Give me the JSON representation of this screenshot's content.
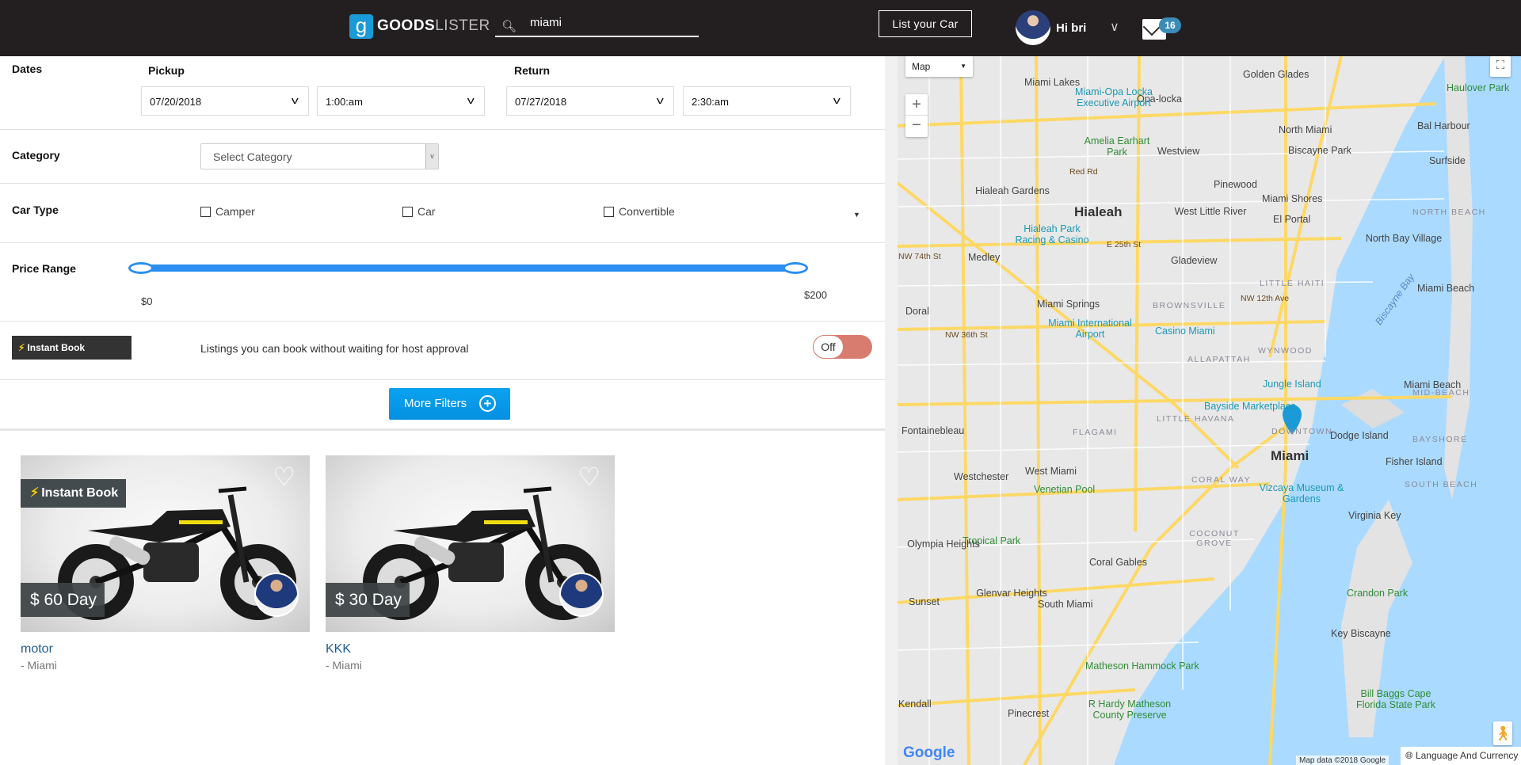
{
  "header": {
    "logo_bold": "GOODS",
    "logo_light": "LISTER",
    "search_value": "miami",
    "list_button": "List your Car",
    "greeting": "Hi bri",
    "message_count": "16"
  },
  "filters": {
    "dates_label": "Dates",
    "pickup_label": "Pickup",
    "return_label": "Return",
    "pickup_date": "07/20/2018",
    "pickup_time": "1:00:am",
    "return_date": "07/27/2018",
    "return_time": "2:30:am",
    "category_label": "Category",
    "category_placeholder": "Select Category",
    "car_type_label": "Car Type",
    "car_types": [
      {
        "label": "Camper",
        "checked": false
      },
      {
        "label": "Car",
        "checked": false
      },
      {
        "label": "Convertible",
        "checked": false
      }
    ],
    "price_label": "Price Range",
    "price_min": "$0",
    "price_max": "$200",
    "price_range_values": [
      0,
      200
    ],
    "instant_book_label": "Instant Book",
    "instant_book_desc": "Listings you can book without waiting for host approval",
    "instant_book_toggle": "Off",
    "more_filters": "More Filters"
  },
  "listings": [
    {
      "title": "motor",
      "location": "- Miami",
      "price": "$ 60 Day",
      "instant_book": "Instant Book"
    },
    {
      "title": "KKK",
      "location": "- Miami",
      "price": "$ 30 Day"
    }
  ],
  "map": {
    "type_select": "Map",
    "zoom_in": "+",
    "zoom_out": "−",
    "attribution": "Map data ©2018 Google",
    "google_logo": "Google",
    "language_button": "Language And Currency",
    "water_color": "#aadaff",
    "land_color": "#e8e8e8",
    "road_color": "#fdd865",
    "labels": [
      "Miami Lakes",
      "Golden Glades",
      "Opa-locka",
      "Miami-Opa Locka Executive Airport",
      "Haulover Park",
      "North Miami",
      "Bal Harbour",
      "Amelia Earhart Park",
      "Westview",
      "Biscayne Park",
      "Surfside",
      "Hialeah Gardens",
      "Pinewood",
      "Miami Shores",
      "Hialeah",
      "West Little River",
      "El Portal",
      "Hialeah Park Racing & Casino",
      "North Bay Village",
      "Medley",
      "Gladeview",
      "Miami Beach",
      "Biscayne Bay",
      "Doral",
      "Miami Springs",
      "Miami International Airport",
      "Casino Miami",
      "LITTLE HAITI",
      "BROWNSVILLE",
      "WYNWOOD",
      "ALLAPATTAH",
      "Jungle Island",
      "Miami Beach",
      "Bayside Marketplace",
      "Fontainebleau",
      "FLAGAMI",
      "LITTLE HAVANA",
      "Dodge Island",
      "DOWNTOWN",
      "Miami",
      "Fisher Island",
      "Westchester",
      "West Miami",
      "CORAL WAY",
      "Venetian Pool",
      "Vizcaya Museum & Gardens",
      "Virginia Key",
      "Tropical Park",
      "Olympia Heights",
      "COCONUT GROVE",
      "Coral Gables",
      "Crandon Park",
      "Glenvar Heights",
      "Sunset",
      "South Miami",
      "Key Biscayne",
      "Matheson Hammock Park",
      "Kendall",
      "Pinecrest",
      "R Hardy Matheson County Preserve",
      "Bill Baggs Cape Florida State Park",
      "NW 74th St",
      "NW 36th St",
      "E 25th St",
      "Red Rd",
      "NW 12th Ave",
      "NORTH BEACH",
      "MID-BEACH",
      "BAYSHORE",
      "SOUTH BEACH"
    ]
  }
}
